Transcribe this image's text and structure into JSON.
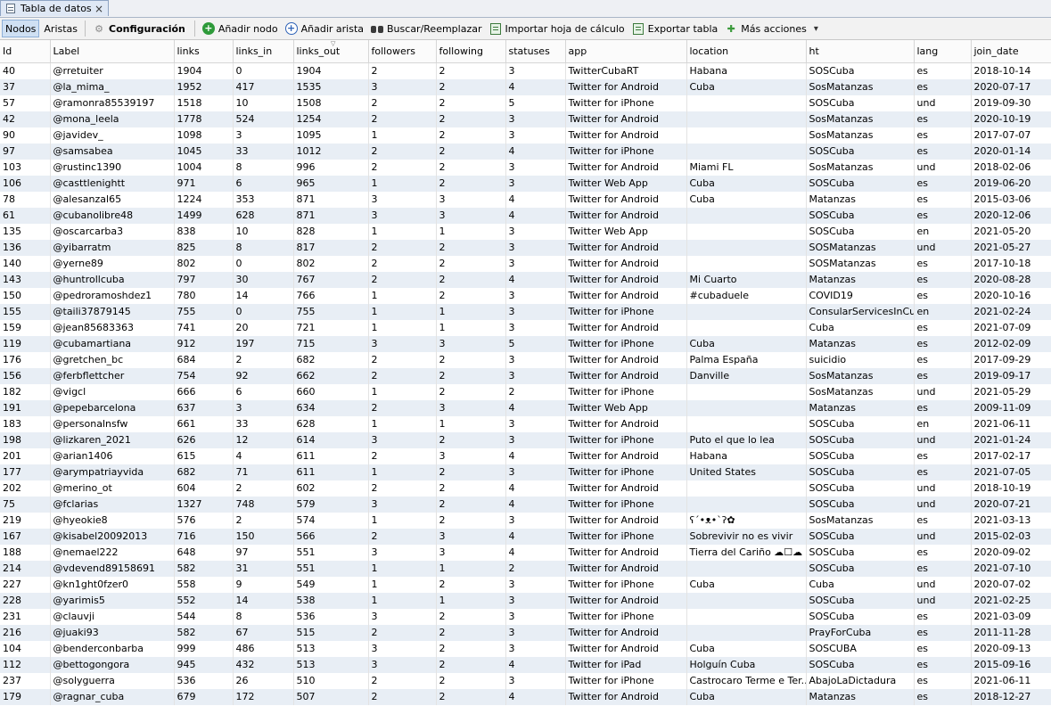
{
  "tab": {
    "title": "Tabla de datos",
    "close": "×"
  },
  "toolbar": {
    "nodes": "Nodos",
    "edges": "Aristas",
    "config": "Configuración",
    "add_node": "Añadir nodo",
    "add_edge": "Añadir arista",
    "find_replace": "Buscar/Reemplazar",
    "import": "Importar hoja de cálculo",
    "export": "Exportar tabla",
    "more": "Más acciones"
  },
  "columns": [
    "Id",
    "Label",
    "links",
    "links_in",
    "links_out",
    "followers",
    "following",
    "statuses",
    "app",
    "location",
    "ht",
    "lang",
    "join_date"
  ],
  "rows": [
    [
      "40",
      "@rretuiter",
      "1904",
      "0",
      "1904",
      "2",
      "2",
      "3",
      "TwitterCubaRT",
      "Habana",
      "SOSCuba",
      "es",
      "2018-10-14"
    ],
    [
      "37",
      "@la_mima_",
      "1952",
      "417",
      "1535",
      "3",
      "2",
      "4",
      "Twitter for Android",
      "Cuba",
      "SosMatanzas",
      "es",
      "2020-07-17"
    ],
    [
      "57",
      "@ramonra85539197",
      "1518",
      "10",
      "1508",
      "2",
      "2",
      "5",
      "Twitter for iPhone",
      "",
      "SOSCuba",
      "und",
      "2019-09-30"
    ],
    [
      "42",
      "@mona_leela",
      "1778",
      "524",
      "1254",
      "2",
      "2",
      "3",
      "Twitter for Android",
      "",
      "SosMatanzas",
      "es",
      "2020-10-19"
    ],
    [
      "90",
      "@javidev_",
      "1098",
      "3",
      "1095",
      "1",
      "2",
      "3",
      "Twitter for Android",
      "",
      "SosMatanzas",
      "es",
      "2017-07-07"
    ],
    [
      "97",
      "@samsabea",
      "1045",
      "33",
      "1012",
      "2",
      "2",
      "4",
      "Twitter for iPhone",
      "",
      "SOSCuba",
      "es",
      "2020-01-14"
    ],
    [
      "103",
      "@rustinc1390",
      "1004",
      "8",
      "996",
      "2",
      "2",
      "3",
      "Twitter for Android",
      "Miami  FL",
      "SosMatanzas",
      "und",
      "2018-02-06"
    ],
    [
      "106",
      "@casttlenightt",
      "971",
      "6",
      "965",
      "1",
      "2",
      "3",
      "Twitter Web App",
      "Cuba",
      "SOSCuba",
      "es",
      "2019-06-20"
    ],
    [
      "78",
      "@alesanzal65",
      "1224",
      "353",
      "871",
      "3",
      "3",
      "4",
      "Twitter for Android",
      "Cuba",
      "Matanzas",
      "es",
      "2015-03-06"
    ],
    [
      "61",
      "@cubanolibre48",
      "1499",
      "628",
      "871",
      "3",
      "3",
      "4",
      "Twitter for Android",
      "",
      "SOSCuba",
      "es",
      "2020-12-06"
    ],
    [
      "135",
      "@oscarcarba3",
      "838",
      "10",
      "828",
      "1",
      "1",
      "3",
      "Twitter Web App",
      "",
      "SOSCuba",
      "en",
      "2021-05-20"
    ],
    [
      "136",
      "@yibarratm",
      "825",
      "8",
      "817",
      "2",
      "2",
      "3",
      "Twitter for Android",
      "",
      "SOSMatanzas",
      "und",
      "2021-05-27"
    ],
    [
      "140",
      "@yerne89",
      "802",
      "0",
      "802",
      "2",
      "2",
      "3",
      "Twitter for Android",
      "",
      "SOSMatanzas",
      "es",
      "2017-10-18"
    ],
    [
      "143",
      "@huntrollcuba",
      "797",
      "30",
      "767",
      "2",
      "2",
      "4",
      "Twitter for Android",
      "Mi Cuarto",
      "Matanzas",
      "es",
      "2020-08-28"
    ],
    [
      "150",
      "@pedroramoshdez1",
      "780",
      "14",
      "766",
      "1",
      "2",
      "3",
      "Twitter for Android",
      "#cubaduele",
      "COVID19",
      "es",
      "2020-10-16"
    ],
    [
      "155",
      "@taili37879145",
      "755",
      "0",
      "755",
      "1",
      "1",
      "3",
      "Twitter for iPhone",
      "",
      "ConsularServicesInCuba",
      "en",
      "2021-02-24"
    ],
    [
      "159",
      "@jean85683363",
      "741",
      "20",
      "721",
      "1",
      "1",
      "3",
      "Twitter for Android",
      "",
      "Cuba",
      "es",
      "2021-07-09"
    ],
    [
      "119",
      "@cubamartiana",
      "912",
      "197",
      "715",
      "3",
      "3",
      "5",
      "Twitter for iPhone",
      "Cuba",
      "Matanzas",
      "es",
      "2012-02-09"
    ],
    [
      "176",
      "@gretchen_bc",
      "684",
      "2",
      "682",
      "2",
      "2",
      "3",
      "Twitter for Android",
      "Palma  España",
      "suicidio",
      "es",
      "2017-09-29"
    ],
    [
      "156",
      "@ferbflettcher",
      "754",
      "92",
      "662",
      "2",
      "2",
      "3",
      "Twitter for Android",
      "Danville",
      "SosMatanzas",
      "es",
      "2019-09-17"
    ],
    [
      "182",
      "@vigcl",
      "666",
      "6",
      "660",
      "1",
      "2",
      "2",
      "Twitter for iPhone",
      "",
      "SosMatanzas",
      "und",
      "2021-05-29"
    ],
    [
      "191",
      "@pepebarcelona",
      "637",
      "3",
      "634",
      "2",
      "3",
      "4",
      "Twitter Web App",
      "",
      "Matanzas",
      "es",
      "2009-11-09"
    ],
    [
      "183",
      "@personalnsfw",
      "661",
      "33",
      "628",
      "1",
      "1",
      "3",
      "Twitter for Android",
      "",
      "SOSCuba",
      "en",
      "2021-06-11"
    ],
    [
      "198",
      "@lizkaren_2021",
      "626",
      "12",
      "614",
      "3",
      "2",
      "3",
      "Twitter for iPhone",
      "Puto el que lo lea",
      "SOSCuba",
      "und",
      "2021-01-24"
    ],
    [
      "201",
      "@arian1406",
      "615",
      "4",
      "611",
      "2",
      "3",
      "4",
      "Twitter for Android",
      "Habana",
      "SOSCuba",
      "es",
      "2017-02-17"
    ],
    [
      "177",
      "@arympatriayvida",
      "682",
      "71",
      "611",
      "1",
      "2",
      "3",
      "Twitter for iPhone",
      "United States",
      "SOSCuba",
      "es",
      "2021-07-05"
    ],
    [
      "202",
      "@merino_ot",
      "604",
      "2",
      "602",
      "2",
      "2",
      "4",
      "Twitter for Android",
      "",
      "SOSCuba",
      "und",
      "2018-10-19"
    ],
    [
      "75",
      "@fclarias",
      "1327",
      "748",
      "579",
      "3",
      "2",
      "4",
      "Twitter for iPhone",
      "",
      "SOSCuba",
      "und",
      "2020-07-21"
    ],
    [
      "219",
      "@hyeokie8",
      "576",
      "2",
      "574",
      "1",
      "2",
      "3",
      "Twitter for Android",
      "ʕ´•ᴥ•`ʔ✿",
      "SosMatanzas",
      "es",
      "2021-03-13"
    ],
    [
      "167",
      "@kisabel20092013",
      "716",
      "150",
      "566",
      "2",
      "3",
      "4",
      "Twitter for iPhone",
      "Sobrevivir no es vivir",
      "SOSCuba",
      "und",
      "2015-02-03"
    ],
    [
      "188",
      "@nemael222",
      "648",
      "97",
      "551",
      "3",
      "3",
      "4",
      "Twitter for Android",
      "Tierra del Cariño ☁☐☁",
      "SOSCuba",
      "es",
      "2020-09-02"
    ],
    [
      "214",
      "@vdevend89158691",
      "582",
      "31",
      "551",
      "1",
      "1",
      "2",
      "Twitter for Android",
      "",
      "SOSCuba",
      "es",
      "2021-07-10"
    ],
    [
      "227",
      "@kn1ght0fzer0",
      "558",
      "9",
      "549",
      "1",
      "2",
      "3",
      "Twitter for iPhone",
      "Cuba",
      "Cuba",
      "und",
      "2020-07-02"
    ],
    [
      "228",
      "@yarimis5",
      "552",
      "14",
      "538",
      "1",
      "1",
      "3",
      "Twitter for Android",
      "",
      "SOSCuba",
      "und",
      "2021-02-25"
    ],
    [
      "231",
      "@clauvji",
      "544",
      "8",
      "536",
      "3",
      "2",
      "3",
      "Twitter for iPhone",
      "",
      "SOSCuba",
      "es",
      "2021-03-09"
    ],
    [
      "216",
      "@juaki93",
      "582",
      "67",
      "515",
      "2",
      "2",
      "3",
      "Twitter for Android",
      "",
      "PrayForCuba",
      "es",
      "2011-11-28"
    ],
    [
      "104",
      "@benderconbarba",
      "999",
      "486",
      "513",
      "3",
      "2",
      "3",
      "Twitter for Android",
      "Cuba",
      "SOSCUBA",
      "es",
      "2020-09-13"
    ],
    [
      "112",
      "@bettogongora",
      "945",
      "432",
      "513",
      "3",
      "2",
      "4",
      "Twitter for iPad",
      "Holguín  Cuba",
      "SOSCuba",
      "es",
      "2015-09-16"
    ],
    [
      "237",
      "@solyguerra",
      "536",
      "26",
      "510",
      "2",
      "2",
      "3",
      "Twitter for iPhone",
      "Castrocaro Terme e Ter...",
      "AbajoLaDictadura",
      "es",
      "2021-06-11"
    ],
    [
      "179",
      "@ragnar_cuba",
      "679",
      "172",
      "507",
      "2",
      "2",
      "4",
      "Twitter for Android",
      "Cuba",
      "Matanzas",
      "es",
      "2018-12-27"
    ]
  ]
}
